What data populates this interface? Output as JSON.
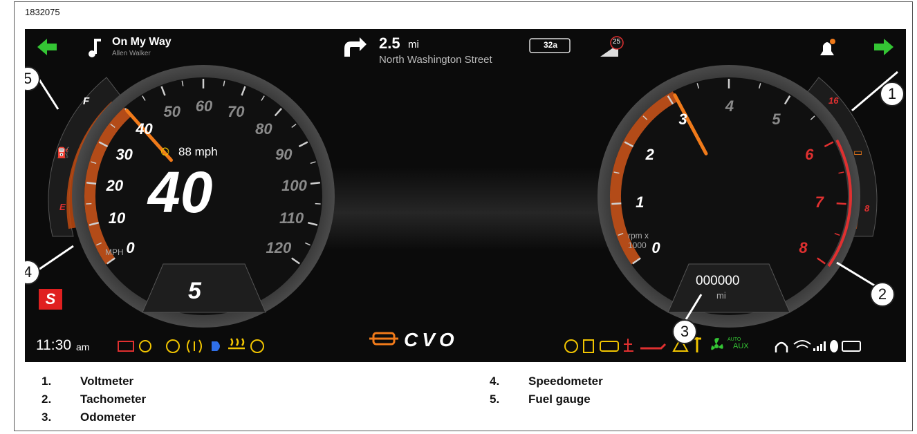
{
  "figure_id": "1832075",
  "top_bar": {
    "song_title": "On My Way",
    "song_artist": "Allen Walker",
    "nav_distance_value": "2.5",
    "nav_distance_unit": "mi",
    "nav_street": "North Washington Street",
    "route_badge": "32a",
    "temperature_badge": "25"
  },
  "speedometer": {
    "ticks": [
      "0",
      "10",
      "20",
      "30",
      "40",
      "50",
      "60",
      "70",
      "80",
      "90",
      "100",
      "110",
      "120"
    ],
    "unit_label": "MPH",
    "current_speed": "40",
    "cruise_set_speed": "88 mph",
    "gear": "5",
    "needle_value_mph": 40
  },
  "fuel_gauge": {
    "full_label": "F",
    "empty_label": "E",
    "level_fraction": 0.6
  },
  "tachometer": {
    "ticks": [
      "0",
      "1",
      "2",
      "3",
      "4",
      "5",
      "6",
      "7",
      "8"
    ],
    "unit_line1": "rpm x",
    "unit_line2": "1000",
    "needle_value_rpm_x1000": 3.1,
    "odometer_value": "000000",
    "odometer_unit": "mi"
  },
  "voltmeter": {
    "top_label": "16",
    "bottom_label": "8",
    "level_fraction": 0.6
  },
  "bottom_bar": {
    "clock_time": "11:30",
    "clock_ampm": "am",
    "aux_label": "AUX",
    "auto_label": "AUTO",
    "brand_text": "CVO",
    "mode_badge": "S"
  },
  "colors": {
    "accent_orange": "#f07a1a",
    "warning_red": "#e03030",
    "indicator_yellow": "#f2c500",
    "indicator_green": "#34c534",
    "headlight_blue": "#2f6fe8"
  },
  "legend": [
    {
      "num": "1.",
      "label": "Voltmeter"
    },
    {
      "num": "2.",
      "label": "Tachometer"
    },
    {
      "num": "3.",
      "label": "Odometer"
    },
    {
      "num": "4.",
      "label": "Speedometer"
    },
    {
      "num": "5.",
      "label": "Fuel gauge"
    }
  ],
  "callouts": [
    "1",
    "2",
    "3",
    "4",
    "5"
  ]
}
